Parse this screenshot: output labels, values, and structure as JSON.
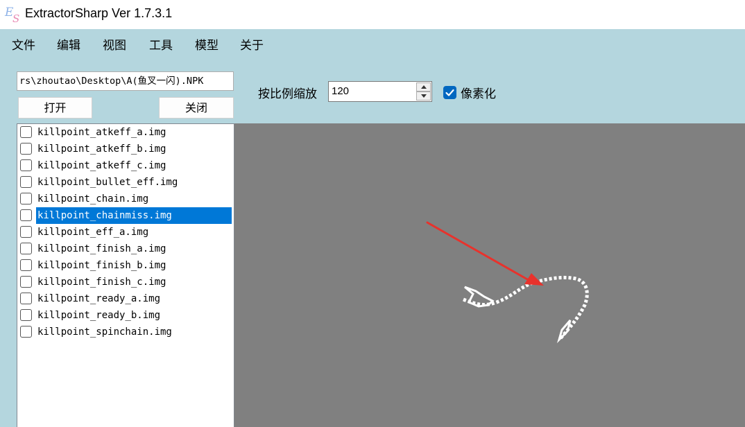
{
  "window": {
    "title": "ExtractorSharp Ver 1.7.3.1",
    "app_icon": "es-logo-icon"
  },
  "menu": [
    "文件",
    "编辑",
    "视图",
    "工具",
    "模型",
    "关于"
  ],
  "file_panel": {
    "path_value": "rs\\zhoutao\\Desktop\\A(鱼叉一闪).NPK",
    "open_label": "打开",
    "close_label": "关闭"
  },
  "toolbar": {
    "zoom_label": "按比例缩放",
    "zoom_value": "120",
    "pixelate_label": "像素化",
    "pixelate_checked": true
  },
  "file_list": {
    "selected_index": 5,
    "items": [
      "killpoint_atkeff_a.img",
      "killpoint_atkeff_b.img",
      "killpoint_atkeff_c.img",
      "killpoint_bullet_eff.img",
      "killpoint_chain.img",
      "killpoint_chainmiss.img",
      "killpoint_eff_a.img",
      "killpoint_finish_a.img",
      "killpoint_finish_b.img",
      "killpoint_finish_c.img",
      "killpoint_ready_a.img",
      "killpoint_ready_b.img",
      "killpoint_spinchain.img"
    ]
  },
  "colors": {
    "window_bg": "#b4d6de",
    "canvas_bg": "#808080",
    "selection": "#0078d7",
    "annotation_arrow": "#e8322c"
  }
}
